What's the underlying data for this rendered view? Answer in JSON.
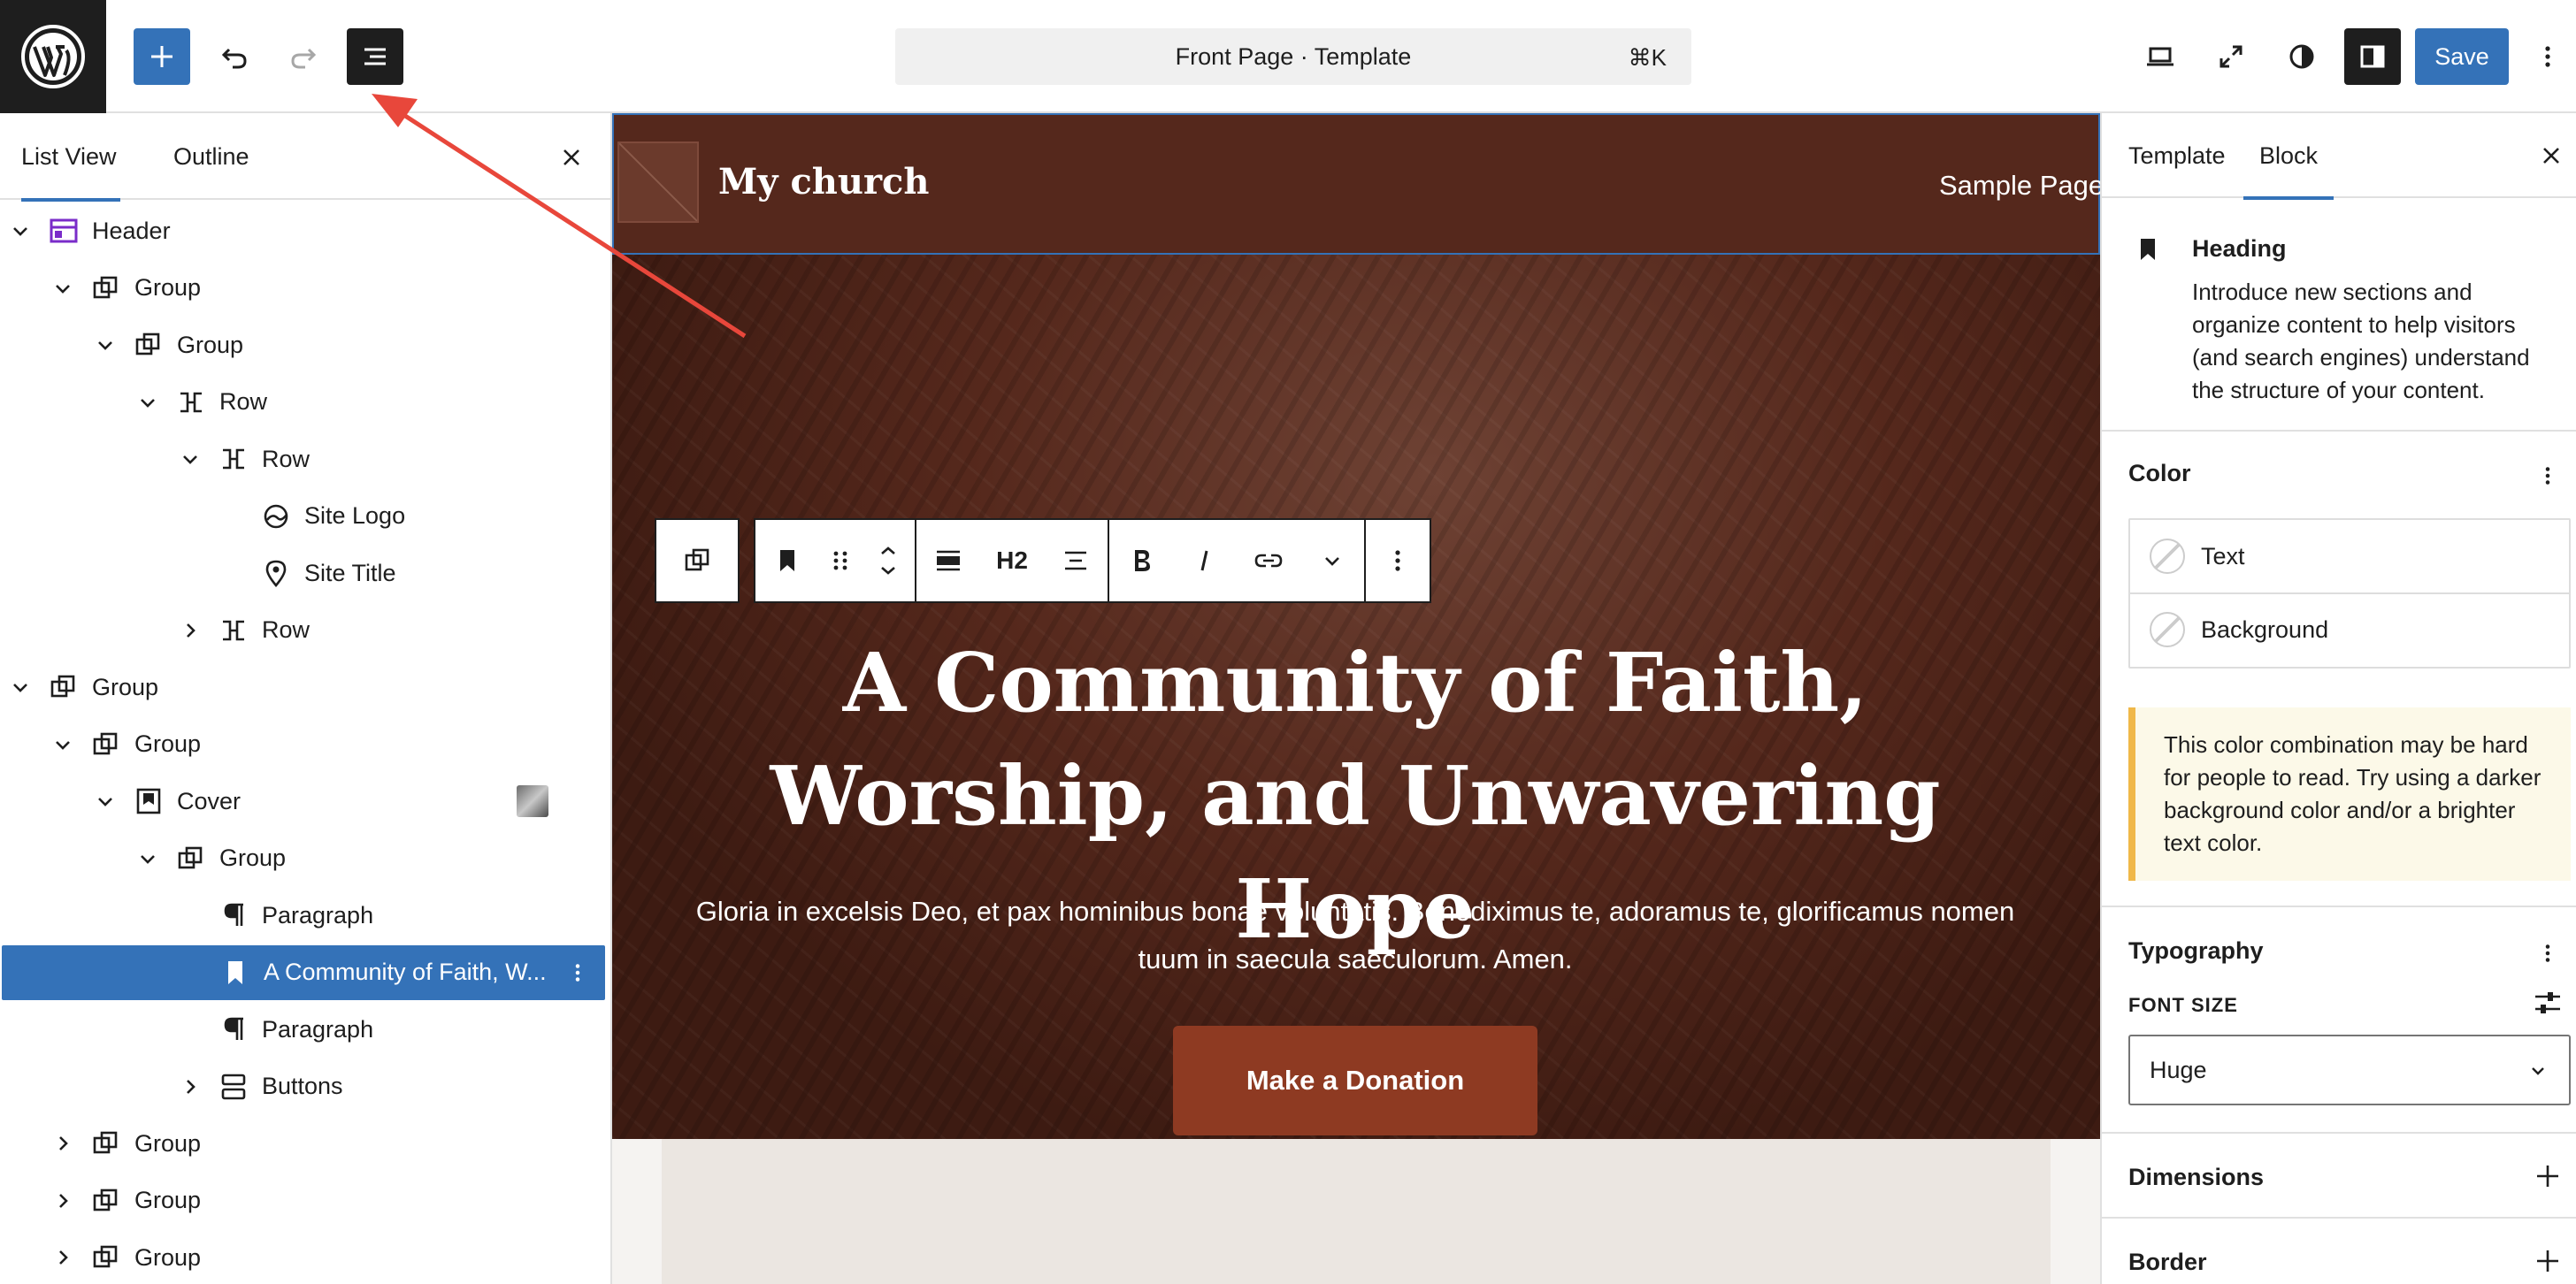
{
  "topbar": {
    "command_title": "Front Page · Template",
    "command_shortcut": "⌘K",
    "save_label": "Save"
  },
  "list_panel": {
    "tabs": [
      "List View",
      "Outline"
    ],
    "tree": [
      {
        "label": "Header",
        "icon": "template-part-icon",
        "depth": 0,
        "expander": "open"
      },
      {
        "label": "Group",
        "icon": "group-icon",
        "depth": 1,
        "expander": "open"
      },
      {
        "label": "Group",
        "icon": "group-icon",
        "depth": 2,
        "expander": "open"
      },
      {
        "label": "Row",
        "icon": "row-icon",
        "depth": 3,
        "expander": "open"
      },
      {
        "label": "Row",
        "icon": "row-icon",
        "depth": 4,
        "expander": "open"
      },
      {
        "label": "Site Logo",
        "icon": "site-logo-icon",
        "depth": 5,
        "expander": "none"
      },
      {
        "label": "Site Title",
        "icon": "map-marker-icon",
        "depth": 5,
        "expander": "none"
      },
      {
        "label": "Row",
        "icon": "row-icon",
        "depth": 4,
        "expander": "closed"
      },
      {
        "label": "Group",
        "icon": "group-icon",
        "depth": 0,
        "expander": "open"
      },
      {
        "label": "Group",
        "icon": "group-icon",
        "depth": 1,
        "expander": "open"
      },
      {
        "label": "Cover",
        "icon": "cover-icon",
        "depth": 2,
        "expander": "open",
        "thumbnail": true
      },
      {
        "label": "Group",
        "icon": "group-icon",
        "depth": 3,
        "expander": "open"
      },
      {
        "label": "Paragraph",
        "icon": "paragraph-icon",
        "depth": 4,
        "expander": "none"
      },
      {
        "label": "A Community of Faith, W...",
        "icon": "heading-icon",
        "depth": 4,
        "expander": "none",
        "selected": true
      },
      {
        "label": "Paragraph",
        "icon": "paragraph-icon",
        "depth": 4,
        "expander": "none"
      },
      {
        "label": "Buttons",
        "icon": "buttons-icon",
        "depth": 4,
        "expander": "closed"
      },
      {
        "label": "Group",
        "icon": "group-icon",
        "depth": 1,
        "expander": "closed"
      },
      {
        "label": "Group",
        "icon": "group-icon",
        "depth": 1,
        "expander": "closed"
      },
      {
        "label": "Group",
        "icon": "group-icon",
        "depth": 1,
        "expander": "closed"
      }
    ]
  },
  "canvas": {
    "site_title": "My church",
    "nav_link": "Sample Page",
    "toolbar_heading_level": "H2",
    "heading": "A Community of Faith, Worship, and Unwavering Hope",
    "paragraph": "Gloria in excelsis Deo, et pax hominibus bonae voluntatis. Benediximus te, adoramus te, glorificamus nomen tuum in saecula saeculorum. Amen.",
    "button_label": "Make a Donation"
  },
  "sidebar": {
    "tabs": {
      "template": "Template",
      "block": "Block"
    },
    "block_card": {
      "title": "Heading",
      "description": "Introduce new sections and organize content to help visitors (and search engines) understand the structure of your content."
    },
    "color": {
      "title": "Color",
      "items": [
        "Text",
        "Background"
      ],
      "warning": "This color combination may be hard for people to read. Try using a darker background color and/or a brighter text color."
    },
    "typography": {
      "title": "Typography",
      "font_size_label": "FONT SIZE",
      "font_size_value": "Huge"
    },
    "dimensions_title": "Dimensions",
    "border_title": "Border"
  },
  "colors": {
    "accent": "#3472b8",
    "header_bg": "#55281c",
    "button_bg": "#8e3a22",
    "annotation_arrow": "#e8473b",
    "warning_border": "#f0b849"
  }
}
